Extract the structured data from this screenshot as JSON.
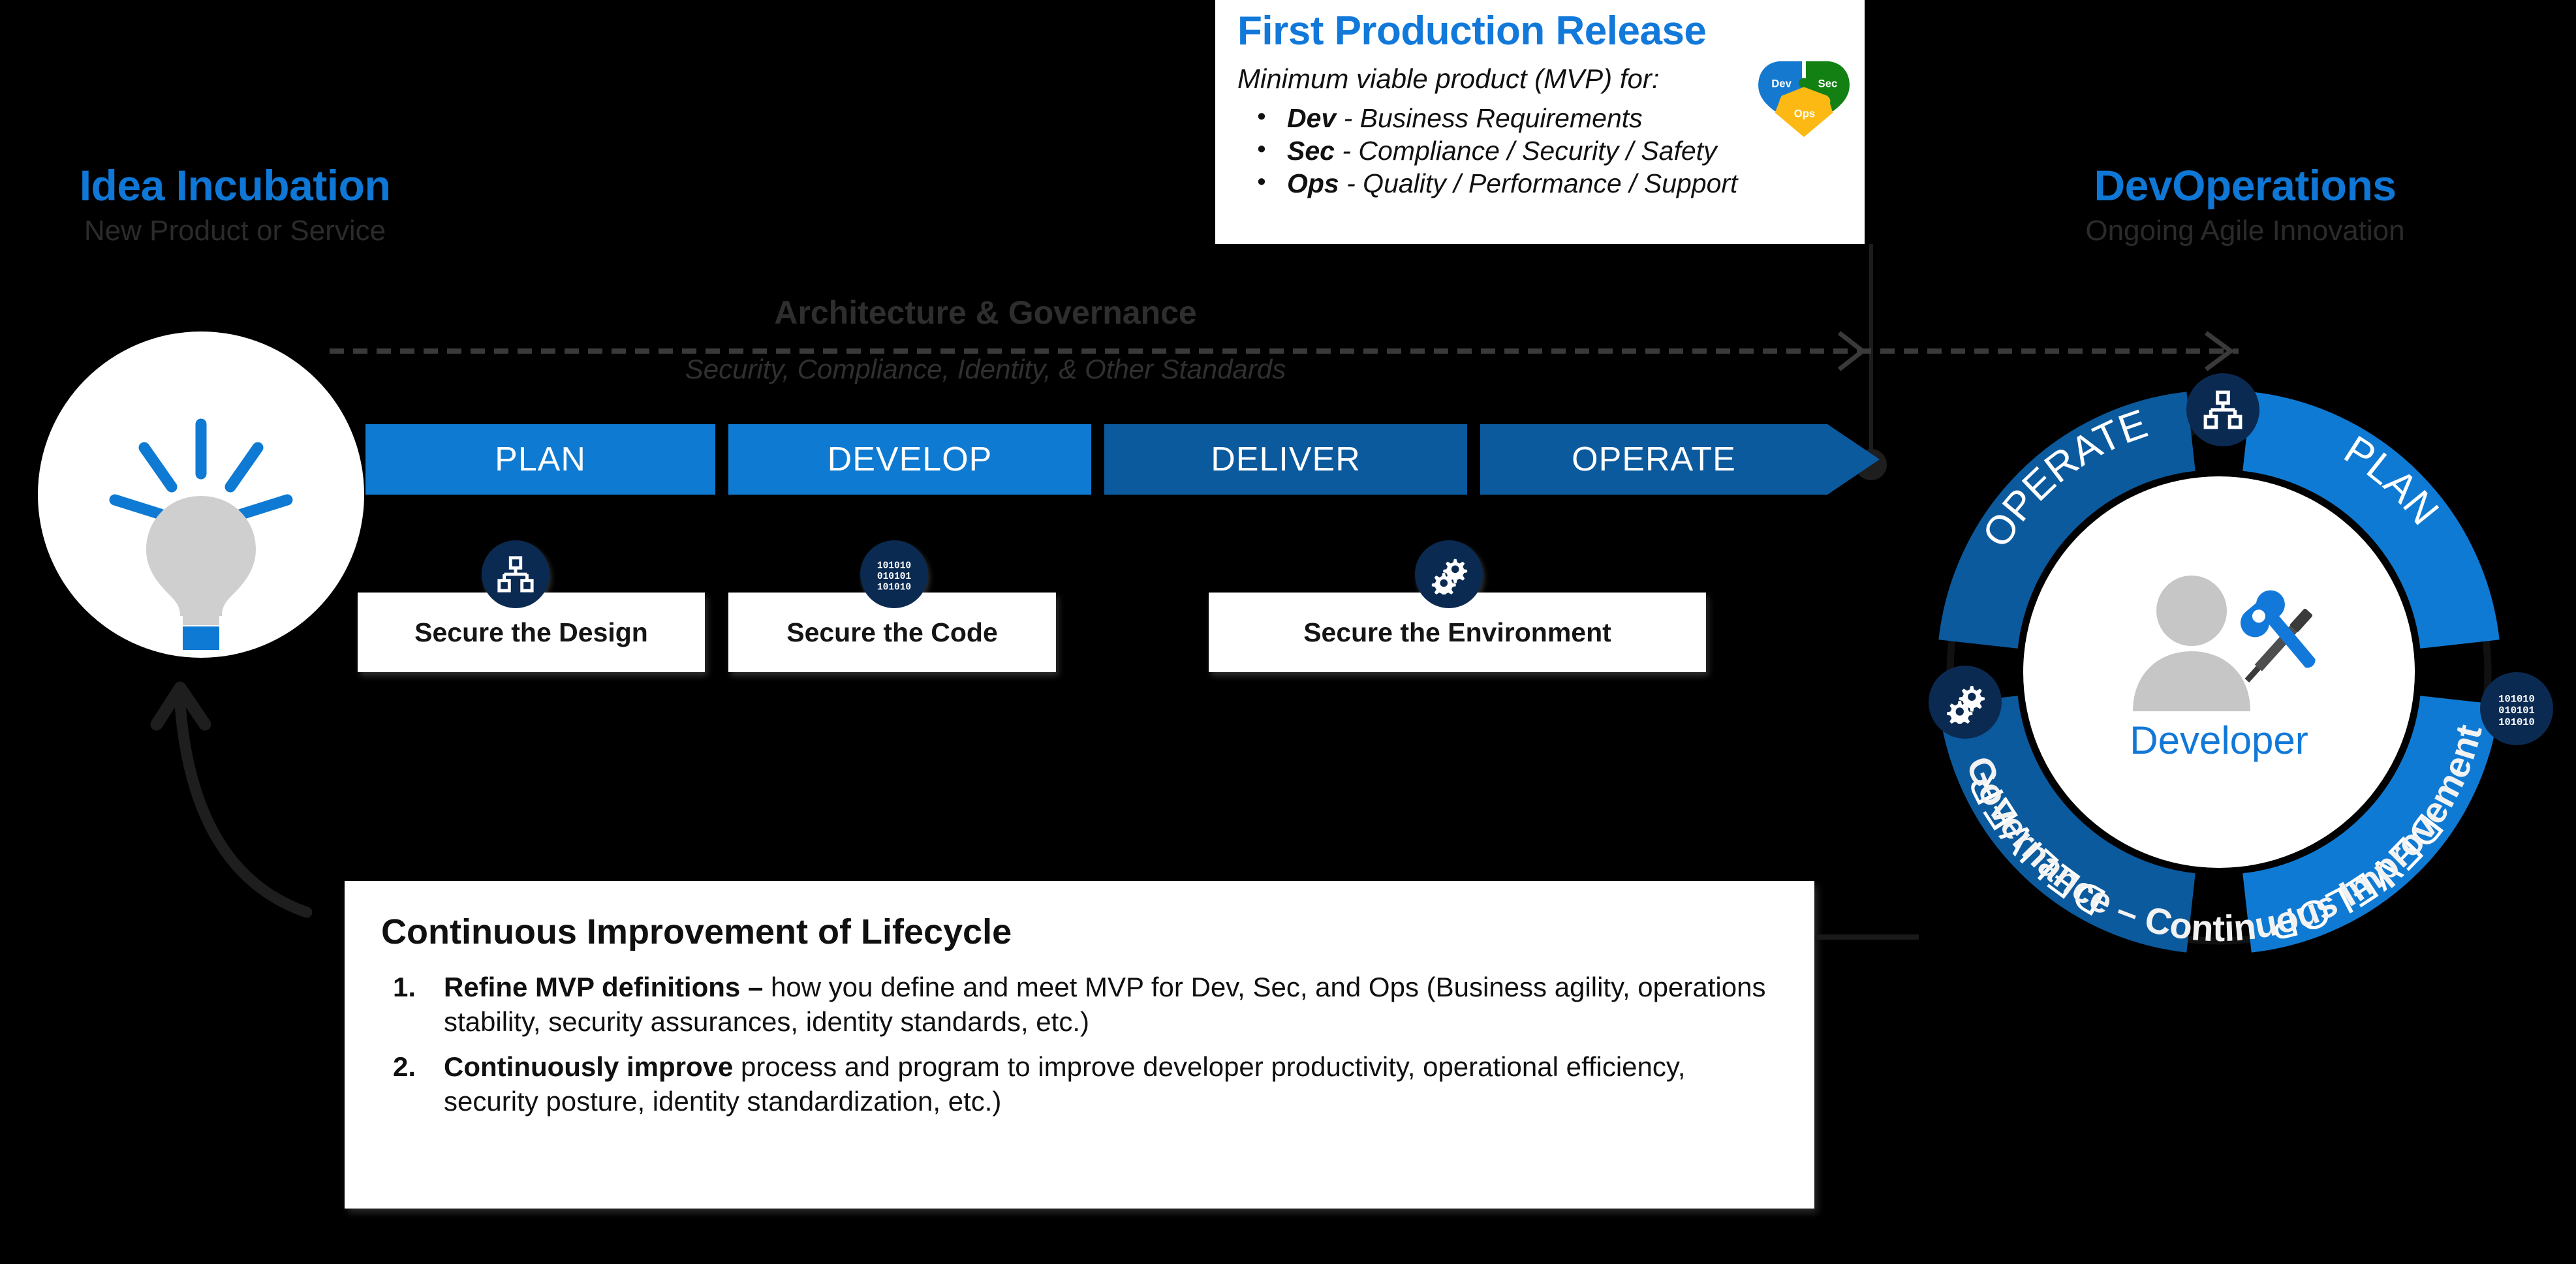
{
  "colors": {
    "background": "#000000",
    "accent_blue": "#0F77D6",
    "pipeline_light": "#0E7AD1",
    "pipeline_dark": "#0B5A9E",
    "badge_navy": "#0B2A52",
    "card_white": "#FFFFFF",
    "muted_text": "#2B2B2B",
    "heart_dev": "#1579D0",
    "heart_sec": "#138013",
    "heart_ops": "#FCB913"
  },
  "left_section": {
    "title": "Idea Incubation",
    "subtitle": "New Product or Service",
    "icon": "lightbulb-icon"
  },
  "right_section": {
    "title": "DevOperations",
    "subtitle": "Ongoing Agile Innovation"
  },
  "mvp_callout": {
    "title": "First Production Release",
    "lead": "Minimum viable product (MVP) for:",
    "items": [
      {
        "term": "Dev",
        "desc": " - Business Requirements"
      },
      {
        "term": "Sec",
        "desc": " - Compliance / Security / Safety"
      },
      {
        "term": "Ops",
        "desc": " - Quality / Performance / Support"
      }
    ],
    "heart_icon": {
      "name": "devsecops-heart-puzzle-icon",
      "pieces": [
        {
          "label": "Dev",
          "color": "#1579D0"
        },
        {
          "label": "Sec",
          "color": "#138013"
        },
        {
          "label": "Ops",
          "color": "#FCB913"
        }
      ]
    }
  },
  "governance_band": {
    "title": "Architecture & Governance",
    "subtitle": "Security, Compliance, Identity, & Other Standards"
  },
  "pipeline": {
    "stages": [
      {
        "label": "PLAN",
        "color": "#0E7AD1"
      },
      {
        "label": "DEVELOP",
        "color": "#0E7AD1"
      },
      {
        "label": "DELIVER",
        "color": "#0B5A9E"
      },
      {
        "label": "OPERATE",
        "color": "#0B5A9E"
      }
    ]
  },
  "secure_cards": [
    {
      "label": "Secure the Design",
      "icon": "hierarchy-icon"
    },
    {
      "label": "Secure the Code",
      "icon": "binary-code-icon"
    },
    {
      "label": "Secure the Environment",
      "icon": "gears-icon"
    }
  ],
  "continuous_improvement": {
    "title": "Continuous Improvement of Lifecycle",
    "items": [
      {
        "bold": "Refine MVP definitions – ",
        "text": "how you define and meet MVP for Dev, Sec, and Ops (Business agility, operations stability, security assurances, identity standards, etc.)"
      },
      {
        "bold": "Continuously improve ",
        "text": "process and program to improve developer productivity, operational efficiency, security posture, identity standardization, etc.)"
      }
    ]
  },
  "devops_wheel": {
    "center_label": "Developer",
    "center_icon": "developer-person-tools-icon",
    "segments": [
      {
        "label": "PLAN",
        "color": "#0F7AD3",
        "icon": "hierarchy-icon"
      },
      {
        "label": "DEVELOP",
        "color": "#0F7AD3",
        "icon": "binary-code-icon"
      },
      {
        "label": "DELIVER",
        "color": "#0B5A9E",
        "icon": null
      },
      {
        "label": "OPERATE",
        "color": "#0B5A9E",
        "icon": "gears-icon"
      }
    ],
    "outer_ring_label": "Governance – Continuous Improvement"
  }
}
